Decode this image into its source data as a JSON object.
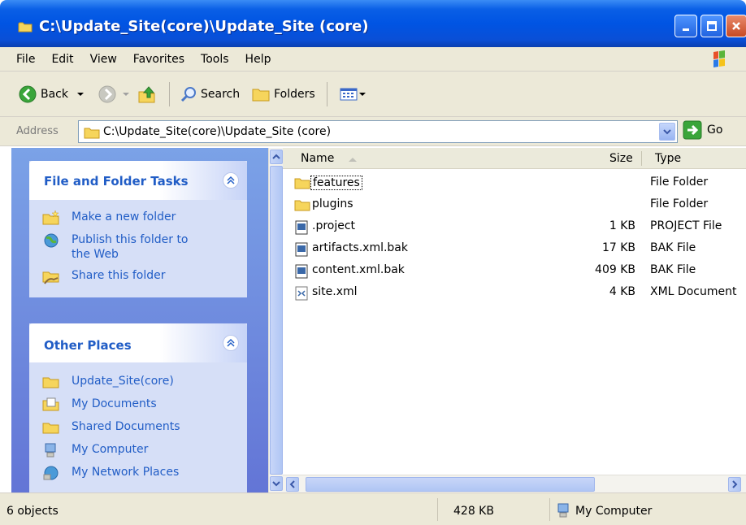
{
  "window": {
    "title": "C:\\Update_Site(core)\\Update_Site (core)"
  },
  "menu": [
    "File",
    "Edit",
    "View",
    "Favorites",
    "Tools",
    "Help"
  ],
  "toolbar": {
    "back_label": "Back",
    "search_label": "Search",
    "folders_label": "Folders"
  },
  "address": {
    "label": "Address",
    "value": "C:\\Update_Site(core)\\Update_Site (core)",
    "go_label": "Go"
  },
  "tasks_panel": {
    "title": "File and Folder Tasks",
    "items": [
      {
        "label": "Make a new folder",
        "icon": "new-folder-icon"
      },
      {
        "label": "Publish this folder to the Web",
        "icon": "publish-web-icon"
      },
      {
        "label": "Share this folder",
        "icon": "share-folder-icon"
      }
    ]
  },
  "places_panel": {
    "title": "Other Places",
    "items": [
      {
        "label": "Update_Site(core)",
        "icon": "folder-icon"
      },
      {
        "label": "My Documents",
        "icon": "my-documents-icon"
      },
      {
        "label": "Shared Documents",
        "icon": "folder-icon"
      },
      {
        "label": "My Computer",
        "icon": "my-computer-icon"
      },
      {
        "label": "My Network Places",
        "icon": "network-places-icon"
      }
    ]
  },
  "columns": {
    "name": "Name",
    "size": "Size",
    "type": "Type"
  },
  "files": [
    {
      "name": "features",
      "size": "",
      "type": "File Folder",
      "icon": "folder-icon"
    },
    {
      "name": "plugins",
      "size": "",
      "type": "File Folder",
      "icon": "folder-icon"
    },
    {
      "name": ".project",
      "size": "1 KB",
      "type": "PROJECT File",
      "icon": "file-icon"
    },
    {
      "name": "artifacts.xml.bak",
      "size": "17 KB",
      "type": "BAK File",
      "icon": "file-icon"
    },
    {
      "name": "content.xml.bak",
      "size": "409 KB",
      "type": "BAK File",
      "icon": "file-icon"
    },
    {
      "name": "site.xml",
      "size": "4 KB",
      "type": "XML Document",
      "icon": "xml-file-icon"
    }
  ],
  "status": {
    "objects": "6 objects",
    "size": "428 KB",
    "zone": "My Computer"
  }
}
